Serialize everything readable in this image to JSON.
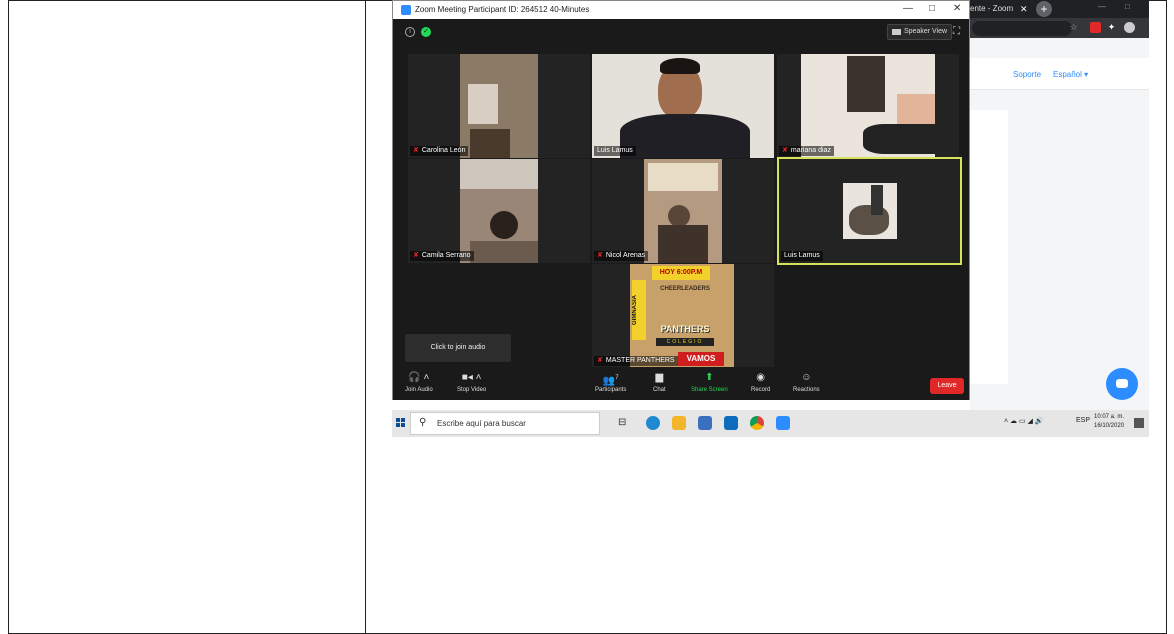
{
  "zoom": {
    "title": "Zoom Meeting Participant ID: 264512   40-Minutes",
    "speaker_view": "Speaker View",
    "tooltip": "Click to join audio",
    "participants_count": "7",
    "tiles": [
      {
        "name": "Carolina León",
        "muted": true
      },
      {
        "name": "Luis Lamus",
        "muted": false
      },
      {
        "name": "mariana diaz",
        "muted": true
      },
      {
        "name": "Camila Serrano",
        "muted": true
      },
      {
        "name": "Nicol Arenas",
        "muted": true
      },
      {
        "name": "Luis Lamus",
        "muted": false
      },
      {
        "name": "MASTER PANTHERS",
        "muted": true
      }
    ],
    "poster": {
      "top": "HOY 6:00P.M",
      "side": "GIMNASIA",
      "arc": "CHEERLEADERS",
      "brand": "PANTHERS",
      "sub": "COLEGIO",
      "bottom": "VAMOS"
    },
    "toolbar": {
      "join_audio": "Join Audio",
      "stop_video": "Stop Video",
      "participants": "Participants",
      "chat": "Chat",
      "share_screen": "Share Screen",
      "record": "Record",
      "reactions": "Reactions",
      "leave": "Leave"
    },
    "accent": "#2d8cff",
    "active_border": "#d6e25a",
    "leave_color": "#e02828"
  },
  "browser": {
    "tab_title": "ente - Zoom",
    "links": [
      "Soporte",
      "Español ▾"
    ]
  },
  "taskbar": {
    "search_placeholder": "Escribe aquí para buscar",
    "language": "ESP",
    "time": "10:07 a. m.",
    "date": "16/10/2020"
  }
}
